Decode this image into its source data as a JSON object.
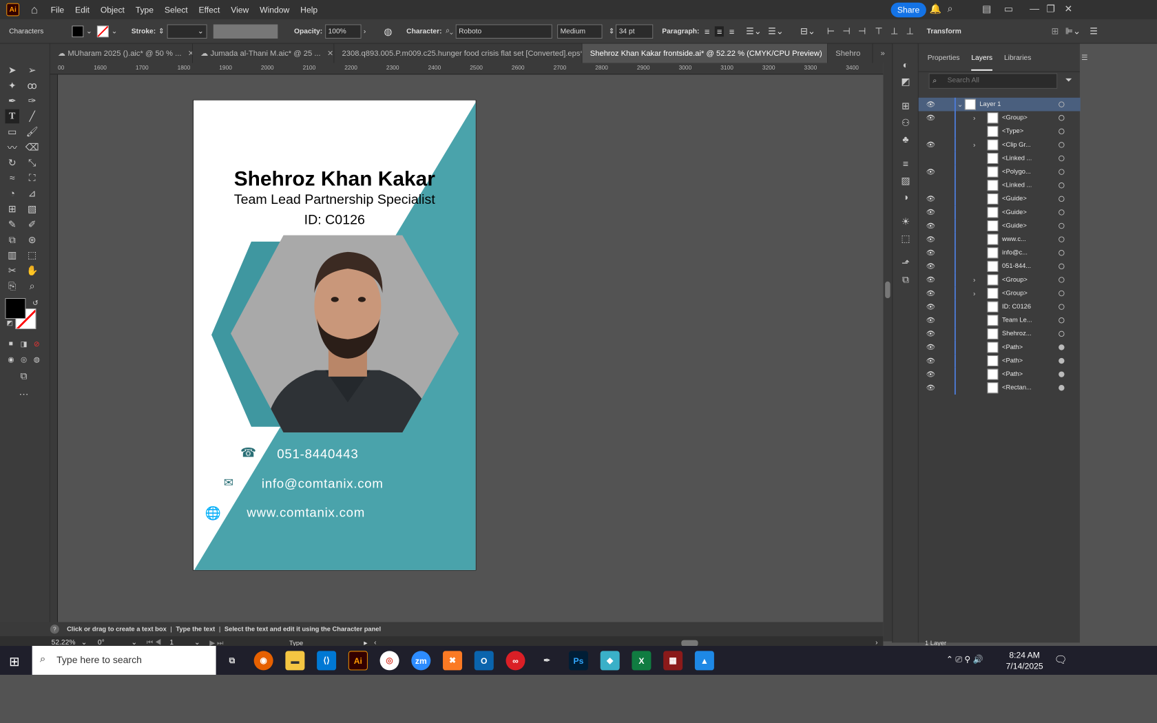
{
  "menubar": {
    "items": [
      "File",
      "Edit",
      "Object",
      "Type",
      "Select",
      "Effect",
      "View",
      "Window",
      "Help"
    ],
    "share": "Share"
  },
  "control": {
    "panel": "Characters",
    "stroke": "Stroke:",
    "opacity_label": "Opacity:",
    "opacity": "100%",
    "character_label": "Character:",
    "font": "Roboto",
    "weight": "Medium",
    "size": "34 pt",
    "paragraph_label": "Paragraph:",
    "transform": "Transform"
  },
  "tabs": [
    {
      "label": "MUharam 2025 ().aic* @ 50 % ..."
    },
    {
      "label": "Jumada al-Thani M.aic* @ 25 ..."
    },
    {
      "label": "2308.q893.005.P.m009.c25.hunger food crisis  flat set [Converted].eps*"
    },
    {
      "label": "Shehroz Khan Kakar  frontside.ai* @ 52.22 % (CMYK/CPU Preview)"
    },
    {
      "label": "Shehro"
    }
  ],
  "ruler": {
    "h": [
      "00",
      "1600",
      "1700",
      "1800",
      "1900",
      "2000",
      "2100",
      "2200",
      "2300",
      "2400",
      "2500",
      "2600",
      "2700",
      "2800",
      "2900",
      "3000",
      "3100",
      "3200",
      "3300",
      "3400"
    ]
  },
  "card": {
    "name": "Shehroz Khan Kakar",
    "title": "Team Lead Partnership Specialist",
    "id": "ID: C0126",
    "phone": "051-8440443",
    "email": "info@comtanix.com",
    "web": "www.comtanix.com",
    "accent": "#4aa3ab"
  },
  "panel": {
    "tabs": [
      "Properties",
      "Layers",
      "Libraries"
    ],
    "search_placeholder": "Search All",
    "layers": [
      {
        "name": "Layer 1"
      },
      {
        "name": "<Group>"
      },
      {
        "name": "<Type>"
      },
      {
        "name": "<Clip Gr..."
      },
      {
        "name": "<Linked ..."
      },
      {
        "name": "<Polygo..."
      },
      {
        "name": "<Linked ..."
      },
      {
        "name": "<Guide>"
      },
      {
        "name": "<Guide>"
      },
      {
        "name": "<Guide>"
      },
      {
        "name": "www.c..."
      },
      {
        "name": "info@c..."
      },
      {
        "name": "051-844..."
      },
      {
        "name": "<Group>"
      },
      {
        "name": "<Group>"
      },
      {
        "name": "ID: C0126"
      },
      {
        "name": "Team Le..."
      },
      {
        "name": "Shehroz..."
      },
      {
        "name": "<Path>"
      },
      {
        "name": "<Path>"
      },
      {
        "name": "<Path>"
      },
      {
        "name": "<Rectan..."
      }
    ],
    "footer": "1 Layer"
  },
  "status": {
    "hint": "Click or drag to create a text box",
    "hint2": "Type the text",
    "hint3": "Select the text and edit it using the Character panel",
    "zoom": "52.22%",
    "rotation": "0°",
    "artboard": "1",
    "tool": "Type"
  },
  "taskbar": {
    "search": "Type here to search",
    "time": "8:24 AM",
    "date": "7/14/2025"
  }
}
